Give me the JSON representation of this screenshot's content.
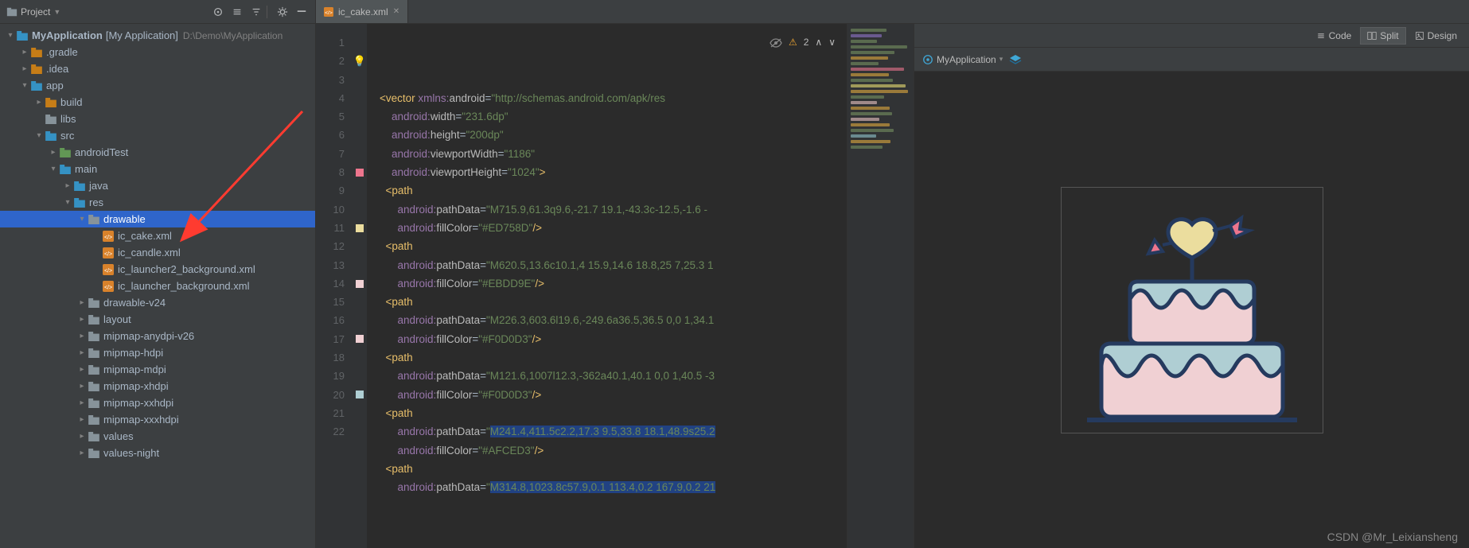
{
  "project_panel": {
    "dropdown_label": "Project",
    "root": {
      "name": "MyApplication",
      "qualifier": "[My Application]",
      "path": "D:\\Demo\\MyApplication"
    },
    "tree": [
      {
        "depth": 1,
        "arrow": "right",
        "icon": "folder-orange",
        "label": ".gradle"
      },
      {
        "depth": 1,
        "arrow": "right",
        "icon": "folder-orange",
        "label": ".idea"
      },
      {
        "depth": 1,
        "arrow": "down",
        "icon": "folder-blue",
        "label": "app"
      },
      {
        "depth": 2,
        "arrow": "right",
        "icon": "folder-orange",
        "label": "build"
      },
      {
        "depth": 2,
        "arrow": "none",
        "icon": "folder",
        "label": "libs"
      },
      {
        "depth": 2,
        "arrow": "down",
        "icon": "folder-blue",
        "label": "src"
      },
      {
        "depth": 3,
        "arrow": "right",
        "icon": "folder-green",
        "label": "androidTest"
      },
      {
        "depth": 3,
        "arrow": "down",
        "icon": "folder-blue",
        "label": "main"
      },
      {
        "depth": 4,
        "arrow": "right",
        "icon": "folder-blue",
        "label": "java"
      },
      {
        "depth": 4,
        "arrow": "down",
        "icon": "folder-blue",
        "label": "res"
      },
      {
        "depth": 5,
        "arrow": "down",
        "icon": "folder",
        "label": "drawable",
        "selected": true
      },
      {
        "depth": 6,
        "arrow": "none",
        "icon": "xml",
        "label": "ic_cake.xml"
      },
      {
        "depth": 6,
        "arrow": "none",
        "icon": "xml",
        "label": "ic_candle.xml"
      },
      {
        "depth": 6,
        "arrow": "none",
        "icon": "xml",
        "label": "ic_launcher2_background.xml"
      },
      {
        "depth": 6,
        "arrow": "none",
        "icon": "xml",
        "label": "ic_launcher_background.xml"
      },
      {
        "depth": 5,
        "arrow": "right",
        "icon": "folder",
        "label": "drawable-v24"
      },
      {
        "depth": 5,
        "arrow": "right",
        "icon": "folder",
        "label": "layout"
      },
      {
        "depth": 5,
        "arrow": "right",
        "icon": "folder",
        "label": "mipmap-anydpi-v26"
      },
      {
        "depth": 5,
        "arrow": "right",
        "icon": "folder",
        "label": "mipmap-hdpi"
      },
      {
        "depth": 5,
        "arrow": "right",
        "icon": "folder",
        "label": "mipmap-mdpi"
      },
      {
        "depth": 5,
        "arrow": "right",
        "icon": "folder",
        "label": "mipmap-xhdpi"
      },
      {
        "depth": 5,
        "arrow": "right",
        "icon": "folder",
        "label": "mipmap-xxhdpi"
      },
      {
        "depth": 5,
        "arrow": "right",
        "icon": "folder",
        "label": "mipmap-xxxhdpi"
      },
      {
        "depth": 5,
        "arrow": "right",
        "icon": "folder",
        "label": "values"
      },
      {
        "depth": 5,
        "arrow": "right",
        "icon": "folder",
        "label": "values-night"
      }
    ]
  },
  "editor": {
    "tab": {
      "filename": "ic_cake.xml"
    },
    "status": {
      "warn_count": "2"
    },
    "lines": [
      {
        "n": 1,
        "html": "<span class='c-br'>&lt;</span><span class='c-tag'>vector</span> <span class='c-ns'>xmlns:</span><span class='c-attr'>android</span><span class='c-eq'>=</span><span class='c-str'>\"http://schemas.android.com/apk/res</span>"
      },
      {
        "n": 2,
        "bulb": true,
        "html": "    <span class='c-ns'>android:</span><span class='c-attr'>width</span><span class='c-eq'>=</span><span class='c-str'>\"231.6dp\"</span>"
      },
      {
        "n": 3,
        "html": "    <span class='c-ns'>android:</span><span class='c-attr'>height</span><span class='c-eq'>=</span><span class='c-str'>\"200dp\"</span>"
      },
      {
        "n": 4,
        "html": "    <span class='c-ns'>android:</span><span class='c-attr'>viewportWidth</span><span class='c-eq'>=</span><span class='c-str'>\"1186\"</span>"
      },
      {
        "n": 5,
        "html": "    <span class='c-ns'>android:</span><span class='c-attr'>viewportHeight</span><span class='c-eq'>=</span><span class='c-str'>\"1024\"</span><span class='c-br'>&gt;</span>"
      },
      {
        "n": 6,
        "html": "  <span class='c-br'>&lt;</span><span class='c-tag'>path</span>"
      },
      {
        "n": 7,
        "html": "      <span class='c-ns'>android:</span><span class='c-attr'>pathData</span><span class='c-eq'>=</span><span class='c-str'>\"M715.9,61.3q9.6,-21.7 19.1,-43.3c-12.5,-1.6 -</span>"
      },
      {
        "n": 8,
        "mark": "#ED758D",
        "html": "      <span class='c-ns'>android:</span><span class='c-attr'>fillColor</span><span class='c-eq'>=</span><span class='c-str'>\"#ED758D\"</span><span class='c-br'>/&gt;</span>"
      },
      {
        "n": 9,
        "html": "  <span class='c-br'>&lt;</span><span class='c-tag'>path</span>"
      },
      {
        "n": 10,
        "html": "      <span class='c-ns'>android:</span><span class='c-attr'>pathData</span><span class='c-eq'>=</span><span class='c-str'>\"M620.5,13.6c10.1,4 15.9,14.6 18.8,25 7,25.3 1</span>"
      },
      {
        "n": 11,
        "mark": "#EBDD9E",
        "html": "      <span class='c-ns'>android:</span><span class='c-attr'>fillColor</span><span class='c-eq'>=</span><span class='c-str'>\"#EBDD9E\"</span><span class='c-br'>/&gt;</span>"
      },
      {
        "n": 12,
        "html": "  <span class='c-br'>&lt;</span><span class='c-tag'>path</span>"
      },
      {
        "n": 13,
        "html": "      <span class='c-ns'>android:</span><span class='c-attr'>pathData</span><span class='c-eq'>=</span><span class='c-str'>\"M226.3,603.6l19.6,-249.6a36.5,36.5 0,0 1,34.1</span>"
      },
      {
        "n": 14,
        "mark": "#F0D0D3",
        "html": "      <span class='c-ns'>android:</span><span class='c-attr'>fillColor</span><span class='c-eq'>=</span><span class='c-str'>\"#F0D0D3\"</span><span class='c-br'>/&gt;</span>"
      },
      {
        "n": 15,
        "html": "  <span class='c-br'>&lt;</span><span class='c-tag'>path</span>"
      },
      {
        "n": 16,
        "html": "      <span class='c-ns'>android:</span><span class='c-attr'>pathData</span><span class='c-eq'>=</span><span class='c-str'>\"M121.6,1007l12.3,-362a40.1,40.1 0,0 1,40.5 -3</span>"
      },
      {
        "n": 17,
        "mark": "#F0D0D3",
        "html": "      <span class='c-ns'>android:</span><span class='c-attr'>fillColor</span><span class='c-eq'>=</span><span class='c-str'>\"#F0D0D3\"</span><span class='c-br'>/&gt;</span>"
      },
      {
        "n": 18,
        "html": "  <span class='c-br'>&lt;</span><span class='c-tag'>path</span>"
      },
      {
        "n": 19,
        "html": "      <span class='c-ns'>android:</span><span class='c-attr'>pathData</span><span class='c-eq'>=</span><span class='c-str'>\"<span class='c-sel'>M241.4,411.5c2.2,17.3 9.5,33.8 18.1,48.9s25.2</span></span>"
      },
      {
        "n": 20,
        "mark": "#AFCED3",
        "html": "      <span class='c-ns'>android:</span><span class='c-attr'>fillColor</span><span class='c-eq'>=</span><span class='c-str'>\"#AFCED3\"</span><span class='c-br'>/&gt;</span>"
      },
      {
        "n": 21,
        "html": "  <span class='c-br'>&lt;</span><span class='c-tag'>path</span>"
      },
      {
        "n": 22,
        "html": "      <span class='c-ns'>android:</span><span class='c-attr'>pathData</span><span class='c-eq'>=</span><span class='c-str'>\"<span class='c-sel'>M314.8,1023.8c57.9,0.1 113.4,0.2 167.9,0.2 21</span></span>"
      }
    ]
  },
  "design": {
    "tabs": {
      "code": "Code",
      "split": "Split",
      "design": "Design"
    },
    "toolbar": {
      "module": "MyApplication"
    }
  },
  "watermark": "CSDN @Mr_Leixiansheng"
}
